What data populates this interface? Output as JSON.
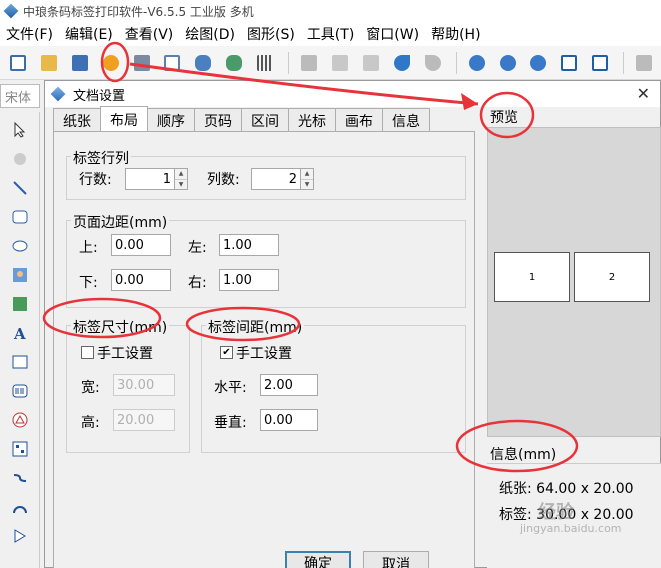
{
  "app": {
    "title": "中琅条码标签打印软件-V6.5.5 工业版 多机"
  },
  "menu": [
    "文件(F)",
    "编辑(E)",
    "查看(V)",
    "绘图(D)",
    "图形(S)",
    "工具(T)",
    "窗口(W)",
    "帮助(H)"
  ],
  "toolbar": {
    "font_name": "宋体"
  },
  "dialog": {
    "title": "文档设置",
    "close": "✕",
    "tabs": [
      "纸张",
      "布局",
      "顺序",
      "页码",
      "区间",
      "光标",
      "画布",
      "信息"
    ],
    "active_tab": "布局",
    "rows_cols": {
      "legend": "标签行列",
      "rows_label": "行数:",
      "rows_value": "1",
      "cols_label": "列数:",
      "cols_value": "2"
    },
    "margins": {
      "legend": "页面边距(mm)",
      "top_label": "上:",
      "top_value": "0.00",
      "left_label": "左:",
      "left_value": "1.00",
      "bottom_label": "下:",
      "bottom_value": "0.00",
      "right_label": "右:",
      "right_value": "1.00"
    },
    "label_size": {
      "legend": "标签尺寸(mm)",
      "manual_label": "手工设置",
      "manual_checked": false,
      "width_label": "宽:",
      "width_value": "30.00",
      "height_label": "高:",
      "height_value": "20.00"
    },
    "label_gap": {
      "legend": "标签间距(mm)",
      "manual_label": "手工设置",
      "manual_checked": true,
      "h_label": "水平:",
      "h_value": "2.00",
      "v_label": "垂直:",
      "v_value": "0.00"
    },
    "preview": {
      "label": "预览",
      "cells": [
        "1",
        "2"
      ]
    },
    "info": {
      "label": "信息(mm)",
      "paper": "纸张: 64.00 x 20.00",
      "label_size": "标签: 30.00 x 20.00"
    },
    "buttons": {
      "ok": "确定",
      "cancel": "取消"
    }
  },
  "watermark": {
    "brand": "经验",
    "url": "jingyan.baidu.com"
  },
  "annotation_color": "#e8333a"
}
